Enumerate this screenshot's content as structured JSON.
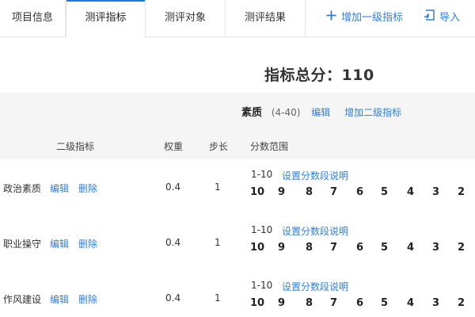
{
  "tabs": [
    {
      "label": "项目信息",
      "active": false
    },
    {
      "label": "测评指标",
      "active": true
    },
    {
      "label": "测评对象",
      "active": false
    },
    {
      "label": "测评结果",
      "active": false
    }
  ],
  "actions": {
    "add_level1": {
      "label": "增加一级指标",
      "icon": "plus-icon"
    },
    "import": {
      "label": "导入",
      "icon": "import-icon"
    }
  },
  "total": {
    "text": "指标总分：110"
  },
  "category": {
    "name": "素质",
    "range": "(4-40)",
    "edit_label": "编辑",
    "add_level2_label": "增加二级指标"
  },
  "columns": {
    "secondary": "二级指标",
    "weight": "权重",
    "step": "步长",
    "score_range": "分数范围"
  },
  "rows": [
    {
      "name": "政治素质",
      "edit": "编辑",
      "delete": "删除",
      "weight": "0.4",
      "step": "1",
      "range": "1-10",
      "set_link": "设置分数段说明",
      "scores": [
        "10",
        "9",
        "8",
        "7",
        "6",
        "5",
        "4",
        "3",
        "2"
      ]
    },
    {
      "name": "职业操守",
      "edit": "编辑",
      "delete": "删除",
      "weight": "0.4",
      "step": "1",
      "range": "1-10",
      "set_link": "设置分数段说明",
      "scores": [
        "10",
        "9",
        "8",
        "7",
        "6",
        "5",
        "4",
        "3",
        "2"
      ]
    },
    {
      "name": "作风建设",
      "edit": "编辑",
      "delete": "删除",
      "weight": "0.4",
      "step": "1",
      "range": "1-10",
      "set_link": "设置分数段说明",
      "scores": [
        "10",
        "9",
        "8",
        "7",
        "6",
        "5",
        "4",
        "3",
        "2"
      ]
    }
  ],
  "colors": {
    "accent": "#2f7fd6",
    "band": "#f5f5f5"
  }
}
